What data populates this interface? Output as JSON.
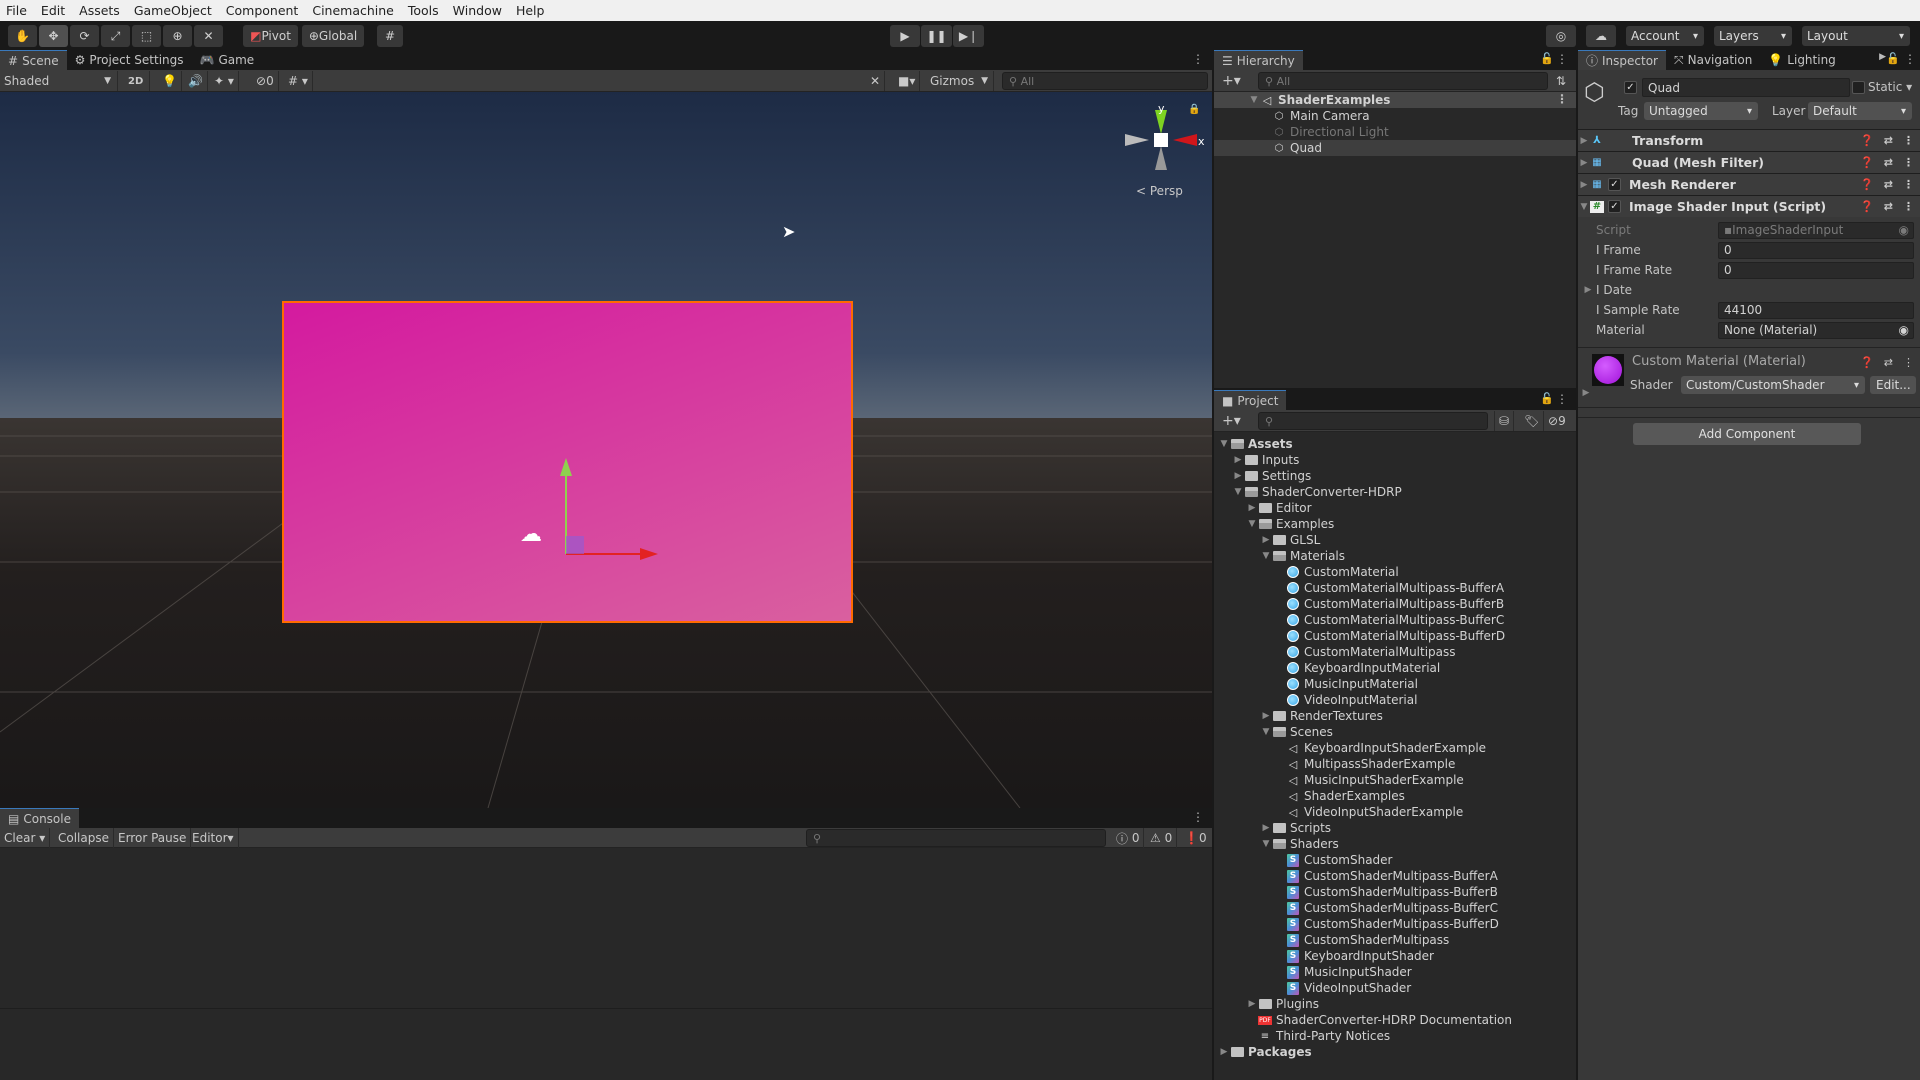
{
  "menu": [
    "File",
    "Edit",
    "Assets",
    "GameObject",
    "Component",
    "Cinemachine",
    "Tools",
    "Window",
    "Help"
  ],
  "toolbar": {
    "pivot": "Pivot",
    "global": "Global",
    "account": "Account",
    "layers": "Layers",
    "layout": "Layout"
  },
  "scene": {
    "tabs": [
      "Scene",
      "Project Settings",
      "Game"
    ],
    "shading": "Shaded",
    "mode_2d": "2D",
    "hidden_count": "0",
    "gizmos": "Gizmos",
    "search_placeholder": "All",
    "persp": "Persp",
    "axis_x": "x",
    "axis_y": "y",
    "colors": {
      "quad_top": "#d41a9f",
      "quad_bottom": "#d9609f",
      "outline": "#ff6a00"
    }
  },
  "console": {
    "tab": "Console",
    "clear": "Clear",
    "collapse": "Collapse",
    "error_pause": "Error Pause",
    "editor": "Editor",
    "info_count": "0",
    "warn_count": "0",
    "error_count": "0"
  },
  "hierarchy": {
    "tab": "Hierarchy",
    "search_placeholder": "All",
    "scene": "ShaderExamples",
    "items": [
      {
        "name": "Main Camera",
        "disabled": false
      },
      {
        "name": "Directional Light",
        "disabled": true
      },
      {
        "name": "Quad",
        "disabled": false,
        "selected": true
      }
    ]
  },
  "project": {
    "tab": "Project",
    "hidden_count": "9",
    "tree": [
      {
        "name": "Assets",
        "depth": 0,
        "type": "folder-open",
        "arrow": "open",
        "bold": true
      },
      {
        "name": "Inputs",
        "depth": 1,
        "type": "folder",
        "arrow": "closed"
      },
      {
        "name": "Settings",
        "depth": 1,
        "type": "folder",
        "arrow": "closed"
      },
      {
        "name": "ShaderConverter-HDRP",
        "depth": 1,
        "type": "folder-open",
        "arrow": "open"
      },
      {
        "name": "Editor",
        "depth": 2,
        "type": "folder",
        "arrow": "closed"
      },
      {
        "name": "Examples",
        "depth": 2,
        "type": "folder-open",
        "arrow": "open"
      },
      {
        "name": "GLSL",
        "depth": 3,
        "type": "folder",
        "arrow": "closed"
      },
      {
        "name": "Materials",
        "depth": 3,
        "type": "folder-open",
        "arrow": "open"
      },
      {
        "name": "CustomMaterial",
        "depth": 4,
        "type": "material"
      },
      {
        "name": "CustomMaterialMultipass-BufferA",
        "depth": 4,
        "type": "material"
      },
      {
        "name": "CustomMaterialMultipass-BufferB",
        "depth": 4,
        "type": "material"
      },
      {
        "name": "CustomMaterialMultipass-BufferC",
        "depth": 4,
        "type": "material"
      },
      {
        "name": "CustomMaterialMultipass-BufferD",
        "depth": 4,
        "type": "material"
      },
      {
        "name": "CustomMaterialMultipass",
        "depth": 4,
        "type": "material"
      },
      {
        "name": "KeyboardInputMaterial",
        "depth": 4,
        "type": "material"
      },
      {
        "name": "MusicInputMaterial",
        "depth": 4,
        "type": "material"
      },
      {
        "name": "VideoInputMaterial",
        "depth": 4,
        "type": "material"
      },
      {
        "name": "RenderTextures",
        "depth": 3,
        "type": "folder",
        "arrow": "closed"
      },
      {
        "name": "Scenes",
        "depth": 3,
        "type": "folder-open",
        "arrow": "open"
      },
      {
        "name": "KeyboardInputShaderExample",
        "depth": 4,
        "type": "scene"
      },
      {
        "name": "MultipassShaderExample",
        "depth": 4,
        "type": "scene"
      },
      {
        "name": "MusicInputShaderExample",
        "depth": 4,
        "type": "scene"
      },
      {
        "name": "ShaderExamples",
        "depth": 4,
        "type": "scene"
      },
      {
        "name": "VideoInputShaderExample",
        "depth": 4,
        "type": "scene"
      },
      {
        "name": "Scripts",
        "depth": 3,
        "type": "folder",
        "arrow": "closed"
      },
      {
        "name": "Shaders",
        "depth": 3,
        "type": "folder-open",
        "arrow": "open"
      },
      {
        "name": "CustomShader",
        "depth": 4,
        "type": "shader"
      },
      {
        "name": "CustomShaderMultipass-BufferA",
        "depth": 4,
        "type": "shader"
      },
      {
        "name": "CustomShaderMultipass-BufferB",
        "depth": 4,
        "type": "shader"
      },
      {
        "name": "CustomShaderMultipass-BufferC",
        "depth": 4,
        "type": "shader"
      },
      {
        "name": "CustomShaderMultipass-BufferD",
        "depth": 4,
        "type": "shader"
      },
      {
        "name": "CustomShaderMultipass",
        "depth": 4,
        "type": "shader"
      },
      {
        "name": "KeyboardInputShader",
        "depth": 4,
        "type": "shader"
      },
      {
        "name": "MusicInputShader",
        "depth": 4,
        "type": "shader"
      },
      {
        "name": "VideoInputShader",
        "depth": 4,
        "type": "shader"
      },
      {
        "name": "Plugins",
        "depth": 2,
        "type": "folder",
        "arrow": "closed"
      },
      {
        "name": "ShaderConverter-HDRP Documentation",
        "depth": 2,
        "type": "pdf"
      },
      {
        "name": "Third-Party Notices",
        "depth": 2,
        "type": "text"
      },
      {
        "name": "Packages",
        "depth": 0,
        "type": "folder",
        "arrow": "closed",
        "bold": true
      }
    ]
  },
  "inspector": {
    "tabs": [
      "Inspector",
      "Navigation",
      "Lighting"
    ],
    "object_name": "Quad",
    "static": "Static",
    "tag_label": "Tag",
    "tag": "Untagged",
    "layer_label": "Layer",
    "layer": "Default",
    "components": [
      "Transform",
      "Quad (Mesh Filter)",
      "Mesh Renderer",
      "Image Shader Input (Script)"
    ],
    "props": [
      {
        "label": "Script",
        "value": "ImageShaderInput"
      },
      {
        "label": "I Frame",
        "value": "0"
      },
      {
        "label": "I Frame Rate",
        "value": "0"
      },
      {
        "label": "I Date"
      },
      {
        "label": "I Sample Rate",
        "value": "44100"
      },
      {
        "label": "Material",
        "value": "None (Material)"
      }
    ],
    "material": {
      "title": "Custom Material (Material)",
      "shader_label": "Shader",
      "shader": "Custom/CustomShader",
      "edit": "Edit..."
    },
    "add_component": "Add Component"
  }
}
